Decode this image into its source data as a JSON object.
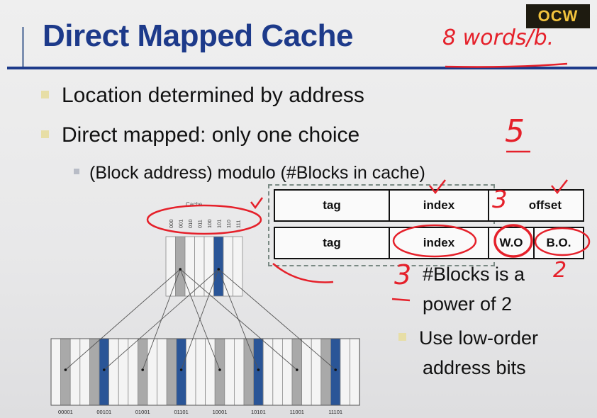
{
  "slide": {
    "title": "Direct Mapped Cache",
    "logo_text": "OCW",
    "bullets": [
      "Location determined by address",
      "Direct mapped: only one choice"
    ],
    "sub_bullet": "(Block address) modulo (#Blocks in cache)",
    "side_bullets": [
      "#Blocks is a",
      "power of 2",
      "Use low-order",
      "address bits"
    ]
  },
  "address_table": {
    "row1": [
      "tag",
      "index",
      "offset"
    ],
    "row2": [
      "tag",
      "index",
      "W.O",
      "B.O."
    ]
  },
  "diagram": {
    "cache_label": "Cache",
    "cache_indices": [
      "000",
      "001",
      "010",
      "011",
      "100",
      "101",
      "110",
      "111"
    ],
    "memory_labels": [
      "00001",
      "00101",
      "01001",
      "01101",
      "10001",
      "10101",
      "11001",
      "11101"
    ]
  },
  "annotations": {
    "words_per_block": "8 words/b.",
    "five": "5",
    "three_offset": "3",
    "three_index": "3",
    "two": "2"
  },
  "colors": {
    "title": "#1d3a8a",
    "highlight_block": "#2a5597",
    "gray_block": "#a9a9a9",
    "ink": "#e5202a"
  }
}
